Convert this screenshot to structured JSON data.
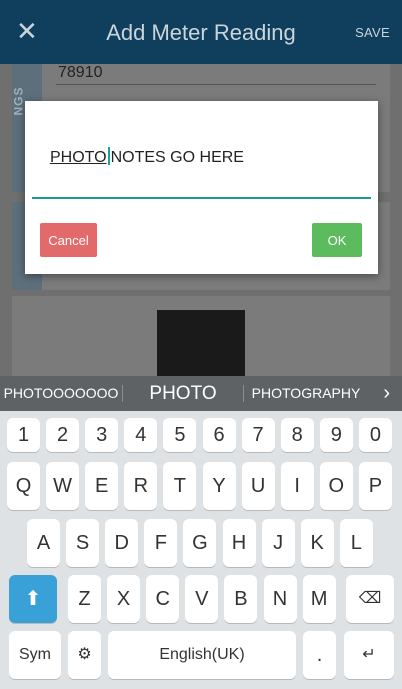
{
  "appbar": {
    "title": "Add Meter Reading",
    "save_label": "SAVE",
    "close_glyph": "✕"
  },
  "form": {
    "reading_value": "78910",
    "section_label": "NGS"
  },
  "dialog": {
    "text_composing": "PHOTO",
    "text_rest": "NOTES GO HERE",
    "cancel_label": "Cancel",
    "ok_label": "OK"
  },
  "keyboard": {
    "suggestions": [
      "PHOTOOOOOOO",
      "PHOTO",
      "PHOTOGRAPHY"
    ],
    "suggest_arrow": "›",
    "row_numbers": [
      "1",
      "2",
      "3",
      "4",
      "5",
      "6",
      "7",
      "8",
      "9",
      "0"
    ],
    "row_top": [
      "Q",
      "W",
      "E",
      "R",
      "T",
      "Y",
      "U",
      "I",
      "O",
      "P"
    ],
    "row_mid": [
      "A",
      "S",
      "D",
      "F",
      "G",
      "H",
      "J",
      "K",
      "L"
    ],
    "row_bottom": [
      "Z",
      "X",
      "C",
      "V",
      "B",
      "N",
      "M"
    ],
    "sym_label": "Sym",
    "space_label": "English(UK)",
    "period_label": ".",
    "shift_glyph": "⬆",
    "backspace_glyph": "⌫",
    "enter_glyph": "↵",
    "settings_glyph": "⚙"
  },
  "colors": {
    "appbar": "#0f3f5c",
    "accent": "#1a9c95",
    "cancel": "#e26a6a",
    "ok": "#5cbb5c",
    "shift": "#3aa0d8"
  }
}
